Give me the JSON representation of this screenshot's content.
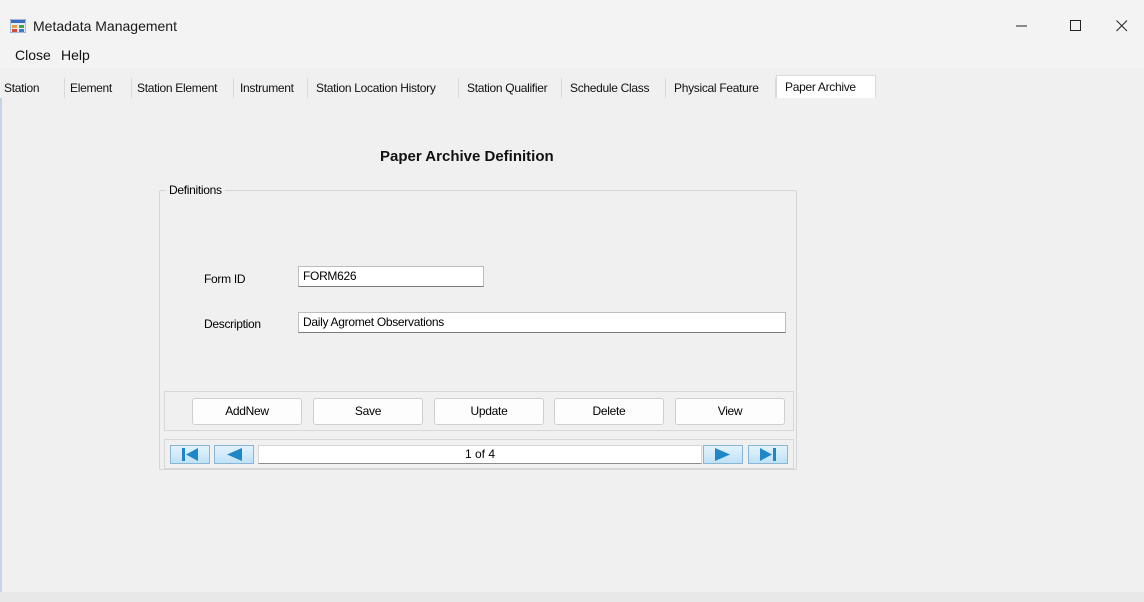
{
  "window": {
    "title": "Metadata Management",
    "minimize_icon": "minimize-icon",
    "maximize_icon": "maximize-icon",
    "close_icon": "close-icon"
  },
  "menu": [
    {
      "label": "Close"
    },
    {
      "label": "Help"
    }
  ],
  "tabs": [
    {
      "label": "Station"
    },
    {
      "label": "Element"
    },
    {
      "label": "Station Element"
    },
    {
      "label": "Instrument"
    },
    {
      "label": "Station Location History"
    },
    {
      "label": "Station Qualifier"
    },
    {
      "label": "Schedule Class"
    },
    {
      "label": "Physical Feature"
    },
    {
      "label": "Paper Archive",
      "active": true
    }
  ],
  "form": {
    "title": "Paper Archive Definition",
    "group_label": "Definitions",
    "form_id_label": "Form ID",
    "form_id_value": "FORM626",
    "description_label": "Description",
    "description_value": "Daily Agromet Observations"
  },
  "buttons": {
    "addnew": "AddNew",
    "save": "Save",
    "update": "Update",
    "delete": "Delete",
    "view": "View"
  },
  "navigator": {
    "record_text": "1 of 4",
    "icons": [
      "first-record-icon",
      "previous-record-icon",
      "next-record-icon",
      "last-record-icon"
    ]
  },
  "colors": {
    "nav_arrow": "#1f86c8",
    "background": "#f0f0f0"
  }
}
